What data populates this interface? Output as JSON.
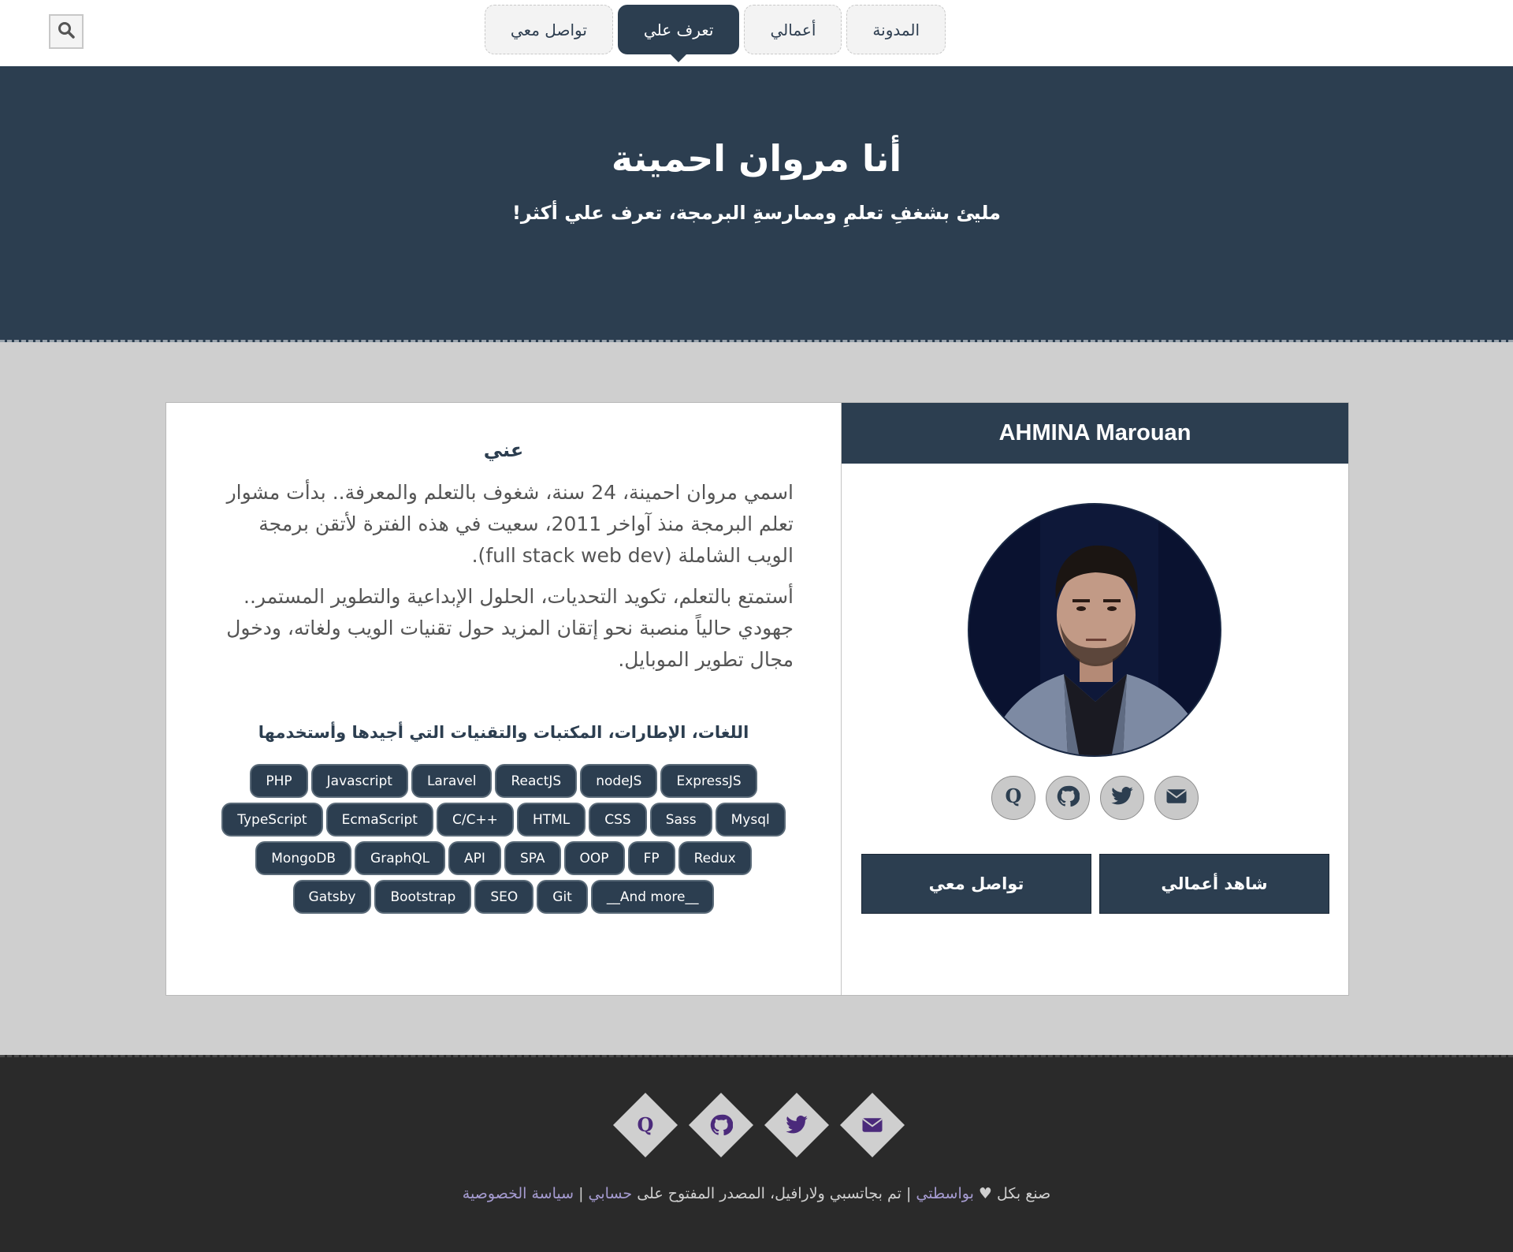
{
  "nav": {
    "items": [
      {
        "label": "المدونة"
      },
      {
        "label": "أعمالي"
      },
      {
        "label": "تعرف علي"
      },
      {
        "label": "تواصل معي"
      }
    ],
    "active_index": 2
  },
  "hero": {
    "title": "أنا مروان احمينة",
    "subtitle": "مليئ بشغفِ تعلمِ وممارسةِ البرمجة، تعرف علي أكثر!"
  },
  "about": {
    "heading": "عني",
    "paragraph1": "اسمي مروان احمينة، 24 سنة، شغوف بالتعلم والمعرفة.. بدأت مشوار تعلم البرمجة منذ آواخر 2011، سعيت في هذه الفترة لأتقن برمجة الويب الشاملة (full stack web dev).",
    "paragraph2": "أستمتع بالتعلم، تكويد التحديات، الحلول الإبداعية والتطوير المستمر.. جهودي حالياً منصبة نحو إتقان المزيد حول تقنيات الويب ولغاته، ودخول مجال تطوير الموبايل.",
    "skills_heading": "اللغات، الإطارات، المكتبات والتقنيات التي أجيدها وأستخدمها",
    "skills": [
      "PHP",
      "Javascript",
      "Laravel",
      "ReactJS",
      "nodeJS",
      "ExpressJS",
      "TypeScript",
      "EcmaScript",
      "C/C++",
      "HTML",
      "CSS",
      "Sass",
      "Mysql",
      "MongoDB",
      "GraphQL",
      "API",
      "SPA",
      "OOP",
      "FP",
      "Redux",
      "Gatsby",
      "Bootstrap",
      "SEO",
      "Git",
      "__And more__"
    ]
  },
  "profile": {
    "name": "AHMINA Marouan",
    "social_icons": [
      "quora-icon",
      "github-icon",
      "twitter-icon",
      "envelope-icon"
    ],
    "btn_contact": "تواصل معي",
    "btn_works": "شاهد أعمالي"
  },
  "footer": {
    "made_with": "صنع بكل",
    "by": "بواسطتي",
    "sep1": "|",
    "built_with": "تم بجاتسبي ولارافيل، المصدر المفتوح على",
    "my_account": "حسابي",
    "sep2": "|",
    "privacy": "سياسة الخصوصية"
  },
  "colors": {
    "primary": "#2c3e50",
    "page_bg": "#cfcfcf",
    "footer_bg": "#2a2a2a",
    "footer_link": "#a59bd0",
    "footer_icon": "#4b2a7b"
  }
}
